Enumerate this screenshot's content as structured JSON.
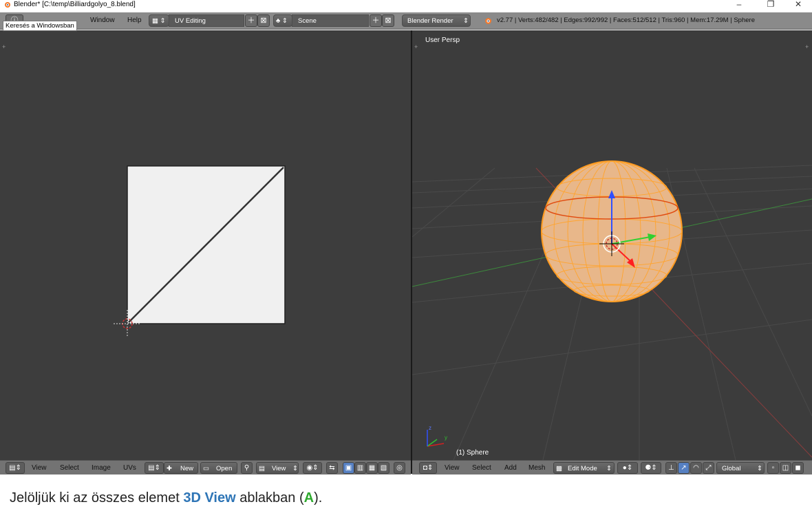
{
  "window": {
    "title": "Blender* [C:\\temp\\Billiardgolyo_8.blend]",
    "minimize": "–",
    "restore": "❐",
    "close": "✕"
  },
  "tooltip": "Keresés a Windowsban",
  "menubar": {
    "window": "Window",
    "help": "Help"
  },
  "layout": {
    "name": "UV Editing"
  },
  "scene": {
    "name": "Scene"
  },
  "render_engine": "Blender Render",
  "stats": "v2.77 | Verts:482/482 | Edges:992/992 | Faces:512/512 | Tris:960 | Mem:17.29M | Sphere",
  "uv_editor": {
    "menus": [
      "View",
      "Select",
      "Image",
      "UVs"
    ],
    "new_label": "New",
    "open_label": "Open",
    "view_label": "View"
  },
  "view3d": {
    "label": "User Persp",
    "object_label": "(1) Sphere",
    "menus": [
      "View",
      "Select",
      "Add",
      "Mesh"
    ],
    "mode": "Edit Mode",
    "orientation": "Global",
    "axis_x": "x",
    "axis_y": "y",
    "axis_z": "z"
  },
  "caption": {
    "pre": "Jelöljük ki az összes elemet ",
    "view": "3D View",
    "mid": " ablakban (",
    "key": "A",
    "post": ")."
  },
  "colors": {
    "accent": "#5680c2",
    "selection": "#ff9a1f",
    "caption_blue": "#2e75b6",
    "caption_green": "#2faa2f"
  }
}
